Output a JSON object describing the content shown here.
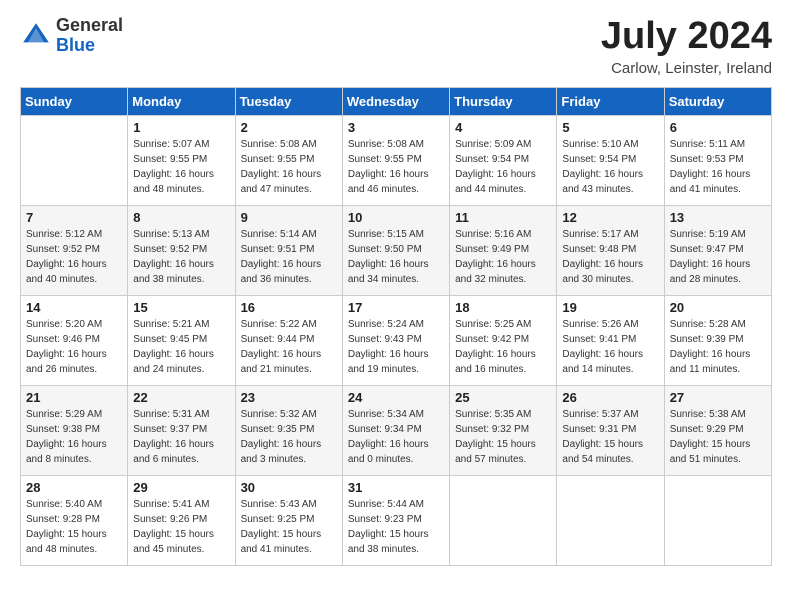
{
  "logo": {
    "general": "General",
    "blue": "Blue"
  },
  "title": "July 2024",
  "location": "Carlow, Leinster, Ireland",
  "headers": [
    "Sunday",
    "Monday",
    "Tuesday",
    "Wednesday",
    "Thursday",
    "Friday",
    "Saturday"
  ],
  "weeks": [
    [
      {
        "day": "",
        "sunrise": "",
        "sunset": "",
        "daylight": ""
      },
      {
        "day": "1",
        "sunrise": "Sunrise: 5:07 AM",
        "sunset": "Sunset: 9:55 PM",
        "daylight": "Daylight: 16 hours and 48 minutes."
      },
      {
        "day": "2",
        "sunrise": "Sunrise: 5:08 AM",
        "sunset": "Sunset: 9:55 PM",
        "daylight": "Daylight: 16 hours and 47 minutes."
      },
      {
        "day": "3",
        "sunrise": "Sunrise: 5:08 AM",
        "sunset": "Sunset: 9:55 PM",
        "daylight": "Daylight: 16 hours and 46 minutes."
      },
      {
        "day": "4",
        "sunrise": "Sunrise: 5:09 AM",
        "sunset": "Sunset: 9:54 PM",
        "daylight": "Daylight: 16 hours and 44 minutes."
      },
      {
        "day": "5",
        "sunrise": "Sunrise: 5:10 AM",
        "sunset": "Sunset: 9:54 PM",
        "daylight": "Daylight: 16 hours and 43 minutes."
      },
      {
        "day": "6",
        "sunrise": "Sunrise: 5:11 AM",
        "sunset": "Sunset: 9:53 PM",
        "daylight": "Daylight: 16 hours and 41 minutes."
      }
    ],
    [
      {
        "day": "7",
        "sunrise": "Sunrise: 5:12 AM",
        "sunset": "Sunset: 9:52 PM",
        "daylight": "Daylight: 16 hours and 40 minutes."
      },
      {
        "day": "8",
        "sunrise": "Sunrise: 5:13 AM",
        "sunset": "Sunset: 9:52 PM",
        "daylight": "Daylight: 16 hours and 38 minutes."
      },
      {
        "day": "9",
        "sunrise": "Sunrise: 5:14 AM",
        "sunset": "Sunset: 9:51 PM",
        "daylight": "Daylight: 16 hours and 36 minutes."
      },
      {
        "day": "10",
        "sunrise": "Sunrise: 5:15 AM",
        "sunset": "Sunset: 9:50 PM",
        "daylight": "Daylight: 16 hours and 34 minutes."
      },
      {
        "day": "11",
        "sunrise": "Sunrise: 5:16 AM",
        "sunset": "Sunset: 9:49 PM",
        "daylight": "Daylight: 16 hours and 32 minutes."
      },
      {
        "day": "12",
        "sunrise": "Sunrise: 5:17 AM",
        "sunset": "Sunset: 9:48 PM",
        "daylight": "Daylight: 16 hours and 30 minutes."
      },
      {
        "day": "13",
        "sunrise": "Sunrise: 5:19 AM",
        "sunset": "Sunset: 9:47 PM",
        "daylight": "Daylight: 16 hours and 28 minutes."
      }
    ],
    [
      {
        "day": "14",
        "sunrise": "Sunrise: 5:20 AM",
        "sunset": "Sunset: 9:46 PM",
        "daylight": "Daylight: 16 hours and 26 minutes."
      },
      {
        "day": "15",
        "sunrise": "Sunrise: 5:21 AM",
        "sunset": "Sunset: 9:45 PM",
        "daylight": "Daylight: 16 hours and 24 minutes."
      },
      {
        "day": "16",
        "sunrise": "Sunrise: 5:22 AM",
        "sunset": "Sunset: 9:44 PM",
        "daylight": "Daylight: 16 hours and 21 minutes."
      },
      {
        "day": "17",
        "sunrise": "Sunrise: 5:24 AM",
        "sunset": "Sunset: 9:43 PM",
        "daylight": "Daylight: 16 hours and 19 minutes."
      },
      {
        "day": "18",
        "sunrise": "Sunrise: 5:25 AM",
        "sunset": "Sunset: 9:42 PM",
        "daylight": "Daylight: 16 hours and 16 minutes."
      },
      {
        "day": "19",
        "sunrise": "Sunrise: 5:26 AM",
        "sunset": "Sunset: 9:41 PM",
        "daylight": "Daylight: 16 hours and 14 minutes."
      },
      {
        "day": "20",
        "sunrise": "Sunrise: 5:28 AM",
        "sunset": "Sunset: 9:39 PM",
        "daylight": "Daylight: 16 hours and 11 minutes."
      }
    ],
    [
      {
        "day": "21",
        "sunrise": "Sunrise: 5:29 AM",
        "sunset": "Sunset: 9:38 PM",
        "daylight": "Daylight: 16 hours and 8 minutes."
      },
      {
        "day": "22",
        "sunrise": "Sunrise: 5:31 AM",
        "sunset": "Sunset: 9:37 PM",
        "daylight": "Daylight: 16 hours and 6 minutes."
      },
      {
        "day": "23",
        "sunrise": "Sunrise: 5:32 AM",
        "sunset": "Sunset: 9:35 PM",
        "daylight": "Daylight: 16 hours and 3 minutes."
      },
      {
        "day": "24",
        "sunrise": "Sunrise: 5:34 AM",
        "sunset": "Sunset: 9:34 PM",
        "daylight": "Daylight: 16 hours and 0 minutes."
      },
      {
        "day": "25",
        "sunrise": "Sunrise: 5:35 AM",
        "sunset": "Sunset: 9:32 PM",
        "daylight": "Daylight: 15 hours and 57 minutes."
      },
      {
        "day": "26",
        "sunrise": "Sunrise: 5:37 AM",
        "sunset": "Sunset: 9:31 PM",
        "daylight": "Daylight: 15 hours and 54 minutes."
      },
      {
        "day": "27",
        "sunrise": "Sunrise: 5:38 AM",
        "sunset": "Sunset: 9:29 PM",
        "daylight": "Daylight: 15 hours and 51 minutes."
      }
    ],
    [
      {
        "day": "28",
        "sunrise": "Sunrise: 5:40 AM",
        "sunset": "Sunset: 9:28 PM",
        "daylight": "Daylight: 15 hours and 48 minutes."
      },
      {
        "day": "29",
        "sunrise": "Sunrise: 5:41 AM",
        "sunset": "Sunset: 9:26 PM",
        "daylight": "Daylight: 15 hours and 45 minutes."
      },
      {
        "day": "30",
        "sunrise": "Sunrise: 5:43 AM",
        "sunset": "Sunset: 9:25 PM",
        "daylight": "Daylight: 15 hours and 41 minutes."
      },
      {
        "day": "31",
        "sunrise": "Sunrise: 5:44 AM",
        "sunset": "Sunset: 9:23 PM",
        "daylight": "Daylight: 15 hours and 38 minutes."
      },
      {
        "day": "",
        "sunrise": "",
        "sunset": "",
        "daylight": ""
      },
      {
        "day": "",
        "sunrise": "",
        "sunset": "",
        "daylight": ""
      },
      {
        "day": "",
        "sunrise": "",
        "sunset": "",
        "daylight": ""
      }
    ]
  ]
}
